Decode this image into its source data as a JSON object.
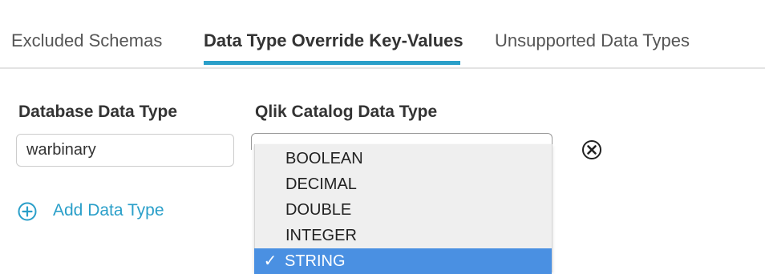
{
  "tabs": [
    {
      "label": "Excluded Schemas"
    },
    {
      "label": "Data Type Override Key-Values"
    },
    {
      "label": "Unsupported Data Types"
    }
  ],
  "form": {
    "db_type_label": "Database Data Type",
    "catalog_type_label": "Qlik Catalog Data Type",
    "db_type_value": "warbinary",
    "add_label": "Add Data Type"
  },
  "dropdown": {
    "options": [
      {
        "label": "BOOLEAN",
        "check": ""
      },
      {
        "label": "DECIMAL",
        "check": ""
      },
      {
        "label": "DOUBLE",
        "check": ""
      },
      {
        "label": "INTEGER",
        "check": ""
      },
      {
        "label": "STRING",
        "check": "✓"
      }
    ],
    "selected": "STRING"
  },
  "colors": {
    "accent": "#2a9fc9",
    "selected_bg": "#4a90e2",
    "dropdown_bg": "#efefef"
  }
}
